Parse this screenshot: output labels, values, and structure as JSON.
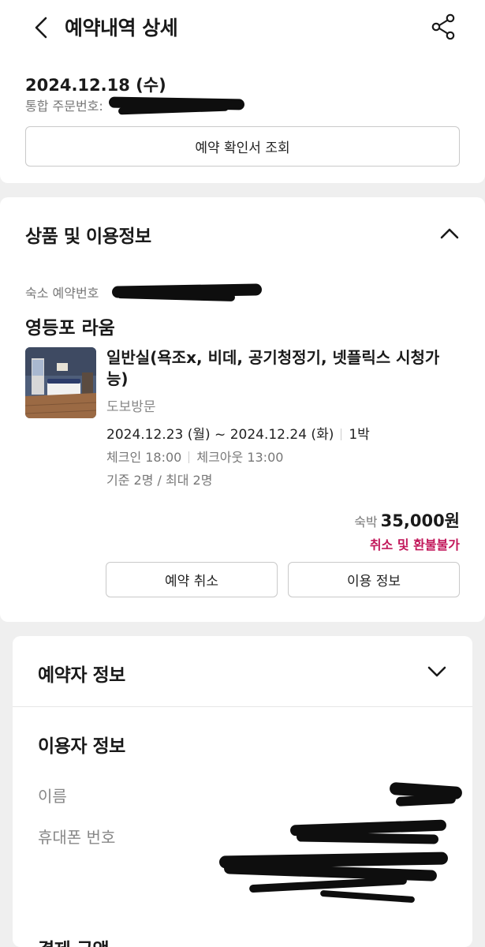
{
  "header": {
    "title": "예약내역 상세"
  },
  "order": {
    "date": "2024.12.18 (수)",
    "number_label": "통합 주문번호:",
    "confirm_button": "예약 확인서 조회"
  },
  "product": {
    "section_title": "상품 및 이용정보",
    "stay_number_label": "숙소 예약번호",
    "hotel_name": "영등포 라움",
    "room_name": "일반실(욕조x, 비데, 공기청정기, 넷플릭스 시청가능)",
    "visit_type": "도보방문",
    "dates": "2024.12.23 (월) ~ 2024.12.24 (화)",
    "nights": "1박",
    "checkin": "체크인 18:00",
    "checkout": "체크아웃 13:00",
    "guests": "기준 2명 / 최대 2명",
    "price_label": "숙박",
    "price": "35,000원",
    "refund_note": "취소 및 환불불가",
    "cancel_button": "예약 취소",
    "info_button": "이용 정보"
  },
  "booker": {
    "section_title": "예약자 정보",
    "user_title": "이용자 정보",
    "name_label": "이름",
    "phone_label": "휴대폰 번호"
  },
  "payment": {
    "section_title": "결제 금액"
  },
  "colors": {
    "accent_red": "#c2185b",
    "background": "#efefef"
  },
  "icons": [
    "back-icon",
    "share-icon",
    "chevron-up-icon",
    "chevron-down-icon"
  ]
}
